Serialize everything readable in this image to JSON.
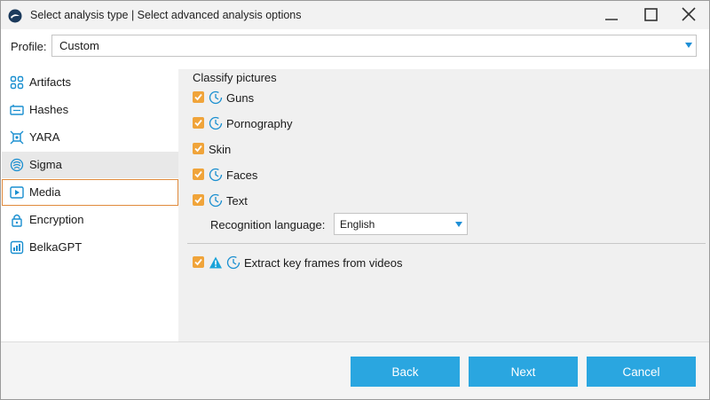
{
  "window": {
    "title": "Select analysis type | Select advanced analysis options",
    "icons": [
      "app-icon",
      "minimize-icon",
      "maximize-icon",
      "close-icon"
    ]
  },
  "profile": {
    "label": "Profile:",
    "value": "Custom"
  },
  "sidebar": {
    "items": [
      {
        "label": "Artifacts",
        "icon": "artifacts-icon",
        "state": "normal"
      },
      {
        "label": "Hashes",
        "icon": "hashes-icon",
        "state": "normal"
      },
      {
        "label": "YARA",
        "icon": "yara-icon",
        "state": "normal"
      },
      {
        "label": "Sigma",
        "icon": "sigma-icon",
        "state": "hover"
      },
      {
        "label": "Media",
        "icon": "media-icon",
        "state": "selected"
      },
      {
        "label": "Encryption",
        "icon": "lock-icon",
        "state": "normal"
      },
      {
        "label": "BelkaGPT",
        "icon": "belkagpt-icon",
        "state": "normal"
      }
    ]
  },
  "media": {
    "section_title": "Classify pictures",
    "options": [
      {
        "label": "Guns",
        "checked": true,
        "clock": true
      },
      {
        "label": "Pornography",
        "checked": true,
        "clock": true
      },
      {
        "label": "Skin",
        "checked": true,
        "clock": false
      },
      {
        "label": "Faces",
        "checked": true,
        "clock": true
      },
      {
        "label": "Text",
        "checked": true,
        "clock": true
      }
    ],
    "recognition_language": {
      "label": "Recognition language:",
      "value": "English"
    },
    "extract": {
      "label": "Extract key frames from videos",
      "checked": true,
      "warning": true,
      "clock": true
    }
  },
  "footer": {
    "back_label": "Back",
    "next_label": "Next",
    "cancel_label": "Cancel"
  },
  "colors": {
    "accent": "#2aa6e0",
    "checkbox": "#f0a43a",
    "selected_border": "#e08a3c",
    "warning": "#1aa3d9"
  }
}
